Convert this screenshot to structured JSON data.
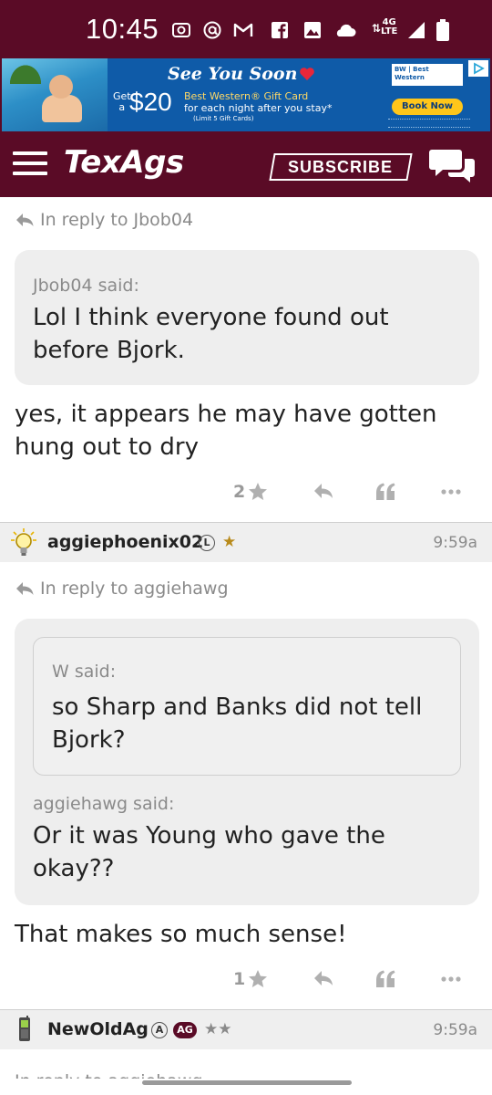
{
  "status_bar": {
    "time": "10:45",
    "network": "4G",
    "network_sub": "LTE",
    "icons": [
      "screen-record-icon",
      "at-icon",
      "gmail-icon",
      "facebook-icon",
      "photos-icon",
      "cloud-icon",
      "data-arrows-icon",
      "signal-icon",
      "battery-icon"
    ]
  },
  "ad": {
    "headline": "See You Soon",
    "get_text": "Get",
    "get_a": "a",
    "amount": "$20",
    "line1": "Best Western® Gift Card",
    "line2": "for each night after you stay*",
    "line3": "(Limit 5 Gift Cards)",
    "logo_text": "BW | Best Western",
    "book_label": "Book Now"
  },
  "header": {
    "logo": "TexAgs",
    "subscribe_label": "SUBSCRIBE"
  },
  "posts": [
    {
      "reply_to": "In reply to Jbob04",
      "quote_author": "Jbob04 said:",
      "quote_text": "Lol I think everyone found out before Bjork.",
      "body": "yes, it appears he may have gotten hung out to dry",
      "star_count": "2"
    },
    {
      "username": "aggiephoenix02",
      "badge": "L",
      "stars": "★",
      "time": "9:59a",
      "reply_to": "In reply to aggiehawg",
      "nested_author": "W said:",
      "nested_text": "so Sharp and Banks did not tell Bjork?",
      "quote_author": "aggiehawg said:",
      "quote_text": "Or it was Young who gave the okay??",
      "body": "That makes so much sense!",
      "star_count": "1"
    },
    {
      "username": "NewOldAg",
      "badge_a": "A",
      "badge_ag": "AG",
      "stars": "★★",
      "time": "9:59a",
      "reply_to": "In reply to aggiehawg"
    }
  ],
  "colors": {
    "maroon": "#5a0b26",
    "quote_bg": "#eeeeee",
    "muted_text": "#8a8a8a",
    "star_gold": "#b88a1a"
  }
}
